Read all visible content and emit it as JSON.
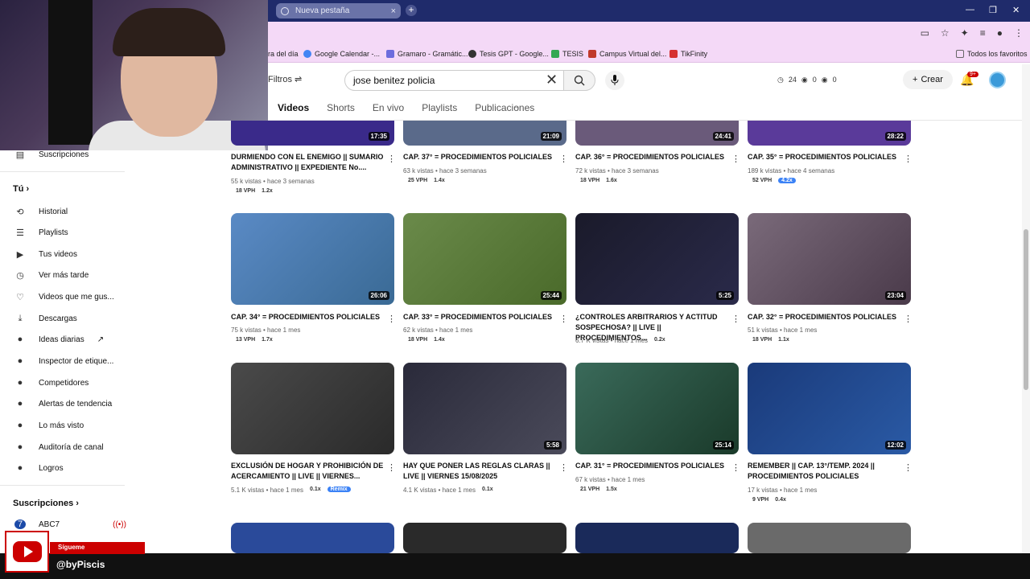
{
  "browser": {
    "tab_title": "Nueva pestaña",
    "bookmarks": [
      {
        "label": "ra del día",
        "color": "#888"
      },
      {
        "label": "Google Calendar -...",
        "color": "#4285f4"
      },
      {
        "label": "Gramaro - Gramátic...",
        "color": "#6c6cdd"
      },
      {
        "label": "Tesis GPT - Google...",
        "color": "#333"
      },
      {
        "label": "TESIS",
        "color": "#34a853"
      },
      {
        "label": "Campus Virtual del...",
        "color": "#c0392b"
      },
      {
        "label": "TikFinity",
        "color": "#d63031"
      }
    ],
    "all_bookmarks": "Todos los favoritos"
  },
  "header": {
    "filters_label": "Filtros",
    "search_value": "jose benitez policia",
    "stats": [
      "24",
      "0",
      "0"
    ],
    "create_label": "Crear",
    "notif_badge": "9+"
  },
  "channel_tabs": [
    "Videos",
    "Shorts",
    "En vivo",
    "Playlists",
    "Publicaciones"
  ],
  "sidebar": {
    "top_item": "Suscripciones",
    "you_label": "Tú",
    "items": [
      {
        "label": "Historial",
        "icon": "history-icon",
        "glyph": "⟲"
      },
      {
        "label": "Playlists",
        "icon": "playlists-icon",
        "glyph": "☰"
      },
      {
        "label": "Tus videos",
        "icon": "your-videos-icon",
        "glyph": "▶"
      },
      {
        "label": "Ver más tarde",
        "icon": "clock-icon",
        "glyph": "◷"
      },
      {
        "label": "Videos que me gus...",
        "icon": "thumbs-up-icon",
        "glyph": "👍"
      },
      {
        "label": "Descargas",
        "icon": "download-icon",
        "glyph": "⤓"
      },
      {
        "label": "Ideas diarias",
        "icon": "ideas-icon",
        "glyph": "●"
      },
      {
        "label": "Inspector de etique...",
        "icon": "tag-inspector-icon",
        "glyph": "●"
      },
      {
        "label": "Competidores",
        "icon": "competitors-icon",
        "glyph": "●"
      },
      {
        "label": "Alertas de tendencia",
        "icon": "trend-alerts-icon",
        "glyph": "●"
      },
      {
        "label": "Lo más visto",
        "icon": "most-viewed-icon",
        "glyph": "●"
      },
      {
        "label": "Auditoría de canal",
        "icon": "channel-audit-icon",
        "glyph": "●"
      },
      {
        "label": "Logros",
        "icon": "achievements-icon",
        "glyph": "●"
      }
    ],
    "subs_title": "Suscripciones",
    "subs_first": "ABC7"
  },
  "videos_row0": [
    {
      "title": "DURMIENDO CON EL ENEMIGO || SUMARIO ADMINISTRATIVO || EXPEDIENTE No....",
      "meta": "55 k vistas • hace 3 semanas",
      "vph": "18 VPH",
      "mult": "1.2x",
      "dur": "17:35",
      "bg": "#3a2a8a"
    },
    {
      "title": "CAP. 37° = PROCEDIMIENTOS POLICIALES",
      "meta": "63 k vistas • hace 3 semanas",
      "vph": "25 VPH",
      "mult": "1.4x",
      "dur": "21:09",
      "bg": "#5a6a8a"
    },
    {
      "title": "CAP. 36° = PROCEDIMIENTOS POLICIALES",
      "meta": "72 k vistas • hace 3 semanas",
      "vph": "18 VPH",
      "mult": "1.6x",
      "dur": "24:41",
      "bg": "#6a5a7a"
    },
    {
      "title": "CAP. 35° = PROCEDIMIENTOS POLICIALES",
      "meta": "189 k vistas • hace 4 semanas",
      "vph": "52 VPH",
      "mult": "4.2x",
      "dur": "28:22",
      "bg": "#5a3a9a"
    }
  ],
  "videos_row1": [
    {
      "title": "CAP. 34° = PROCEDIMIENTOS POLICIALES",
      "meta": "75 k vistas • hace 1 mes",
      "vph": "13 VPH",
      "mult": "1.7x",
      "dur": "26:06",
      "bg": "#4a7ab5"
    },
    {
      "title": "CAP. 33° = PROCEDIMIENTOS POLICIALES",
      "meta": "62 k vistas • hace 1 mes",
      "vph": "18 VPH",
      "mult": "1.4x",
      "dur": "25:44",
      "bg": "#5a7a3a"
    },
    {
      "title": "¿CONTROLES ARBITRARIOS Y ACTITUD SOSPECHOSA? || LIVE || PROCEDIMIENTOS...",
      "meta": "6.7 K vistas • hace 1 mes",
      "vph": "",
      "mult": "0.2x",
      "dur": "5:25",
      "bg": "#1a1a2a"
    },
    {
      "title": "CAP. 32° = PROCEDIMIENTOS POLICIALES",
      "meta": "51 k vistas • hace 1 mes",
      "vph": "18 VPH",
      "mult": "1.1x",
      "dur": "23:04",
      "bg": "#6a5a6a"
    }
  ],
  "videos_row2": [
    {
      "title": "EXCLUSIÓN DE HOGAR Y PROHIBICIÓN DE ACERCAMIENTO || LIVE || VIERNES...",
      "meta": "5.1 K vistas • hace 1 mes",
      "vph": "",
      "mult": "0.1x",
      "extra": "Remix",
      "dur": "",
      "bg": "#3a3a3a"
    },
    {
      "title": "HAY QUE PONER LAS REGLAS CLARAS || LIVE || VIERNES 15/08/2025",
      "meta": "4.1 K vistas • hace 1 mes",
      "vph": "",
      "mult": "0.1x",
      "dur": "5:58",
      "bg": "#2a2a3a"
    },
    {
      "title": "CAP. 31° = PROCEDIMIENTOS POLICIALES",
      "meta": "67 k vistas • hace 1 mes",
      "vph": "21 VPH",
      "mult": "1.5x",
      "dur": "25:14",
      "bg": "#2a5a4a"
    },
    {
      "title": "REMEMBER || CAP. 13°/TEMP. 2024 || PROCEDIMIENTOS POLICIALES",
      "meta": "17 k vistas • hace 1 mes",
      "vph": "9 VPH",
      "mult": "0.4x",
      "dur": "12:02",
      "bg": "#1a3a7a"
    }
  ],
  "videos_row3_bg": [
    "#2a4a9a",
    "#2a2a2a",
    "#1a2a5a",
    "#6a6a6a"
  ],
  "overlay": {
    "follow": "Sígueme",
    "handle": "@byPiscis"
  }
}
